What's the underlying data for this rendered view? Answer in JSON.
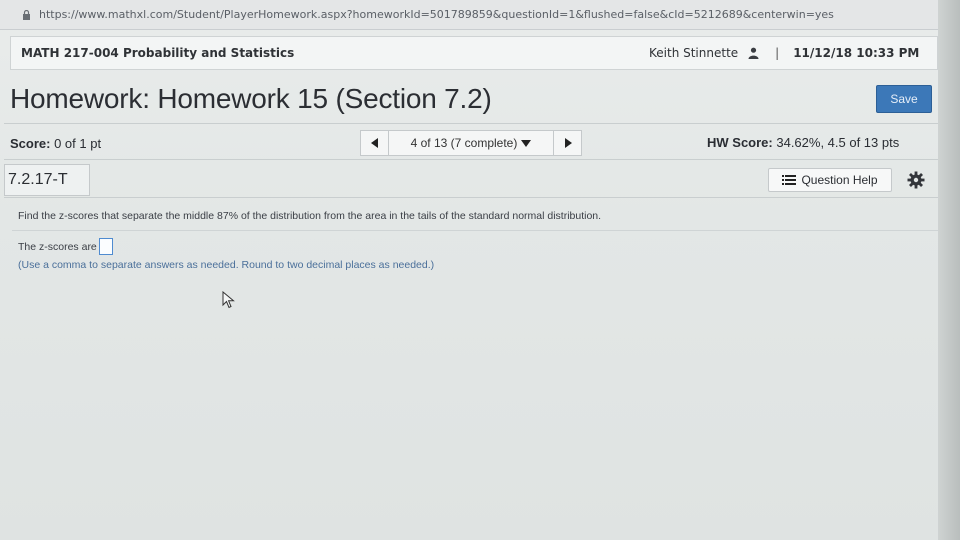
{
  "browser": {
    "url": "https://www.mathxl.com/Student/PlayerHomework.aspx?homeworkId=501789859&questionId=1&flushed=false&cId=5212689&centerwin=yes"
  },
  "course_bar": {
    "course_title": "MATH 217-004 Probability and Statistics",
    "user_name": "Keith Stinnette",
    "separator": "|",
    "datetime": "11/12/18 10:33 PM"
  },
  "homework": {
    "title": "Homework: Homework 15 (Section 7.2)",
    "save_label": "Save"
  },
  "score_row": {
    "score_label": "Score:",
    "score_value": "0 of 1 pt",
    "nav_prev_icon": "triangle-left-icon",
    "nav_progress": "4 of 13 (7 complete)",
    "nav_next_icon": "triangle-right-icon",
    "hw_score_label": "HW Score:",
    "hw_score_value": "34.62%, 4.5 of 13 pts"
  },
  "question": {
    "id": "7.2.17-T",
    "help_label": "Question Help",
    "text": "Find the z-scores that separate the middle 87% of the distribution from the area in the tails of the standard normal distribution.",
    "answer_prompt": "The z-scores are",
    "answer_value": "",
    "hint": "(Use a comma to separate answers as needed. Round to two decimal places as needed.)"
  },
  "colors": {
    "save_button": "#3c78b8",
    "answer_box_border": "#4f8bd0",
    "hint_text": "#4a6f9a"
  }
}
